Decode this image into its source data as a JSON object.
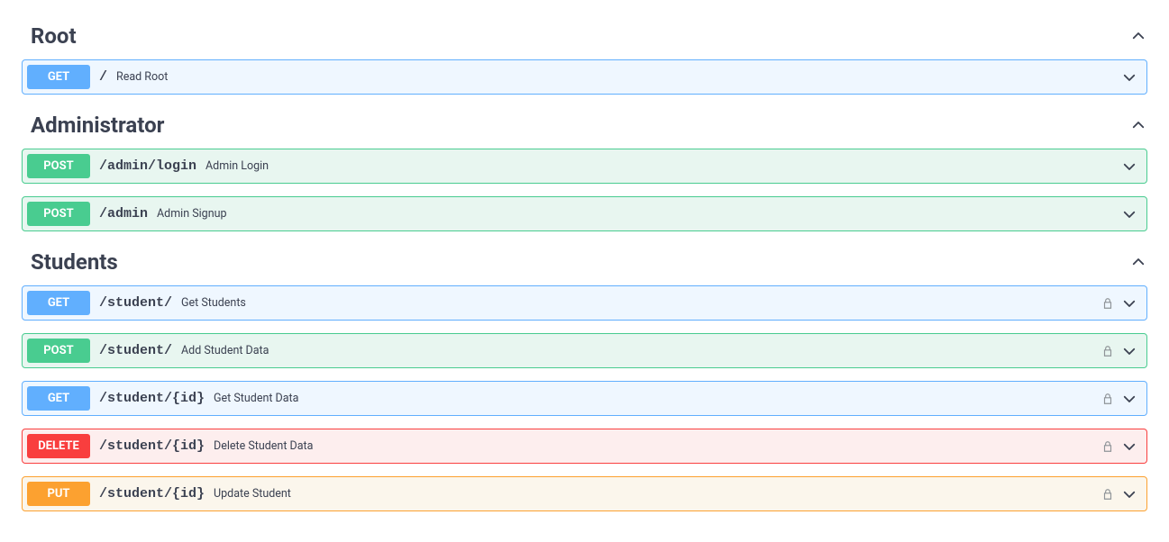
{
  "sections": [
    {
      "title": "Root",
      "endpoints": [
        {
          "method": "GET",
          "path": "/",
          "desc": "Read Root",
          "locked": false
        }
      ]
    },
    {
      "title": "Administrator",
      "endpoints": [
        {
          "method": "POST",
          "path": "/admin/login",
          "desc": "Admin Login",
          "locked": false
        },
        {
          "method": "POST",
          "path": "/admin",
          "desc": "Admin Signup",
          "locked": false
        }
      ]
    },
    {
      "title": "Students",
      "endpoints": [
        {
          "method": "GET",
          "path": "/student/",
          "desc": "Get Students",
          "locked": true
        },
        {
          "method": "POST",
          "path": "/student/",
          "desc": "Add Student Data",
          "locked": true
        },
        {
          "method": "GET",
          "path": "/student/{id}",
          "desc": "Get Student Data",
          "locked": true
        },
        {
          "method": "DELETE",
          "path": "/student/{id}",
          "desc": "Delete Student Data",
          "locked": true
        },
        {
          "method": "PUT",
          "path": "/student/{id}",
          "desc": "Update Student",
          "locked": true
        }
      ]
    }
  ]
}
